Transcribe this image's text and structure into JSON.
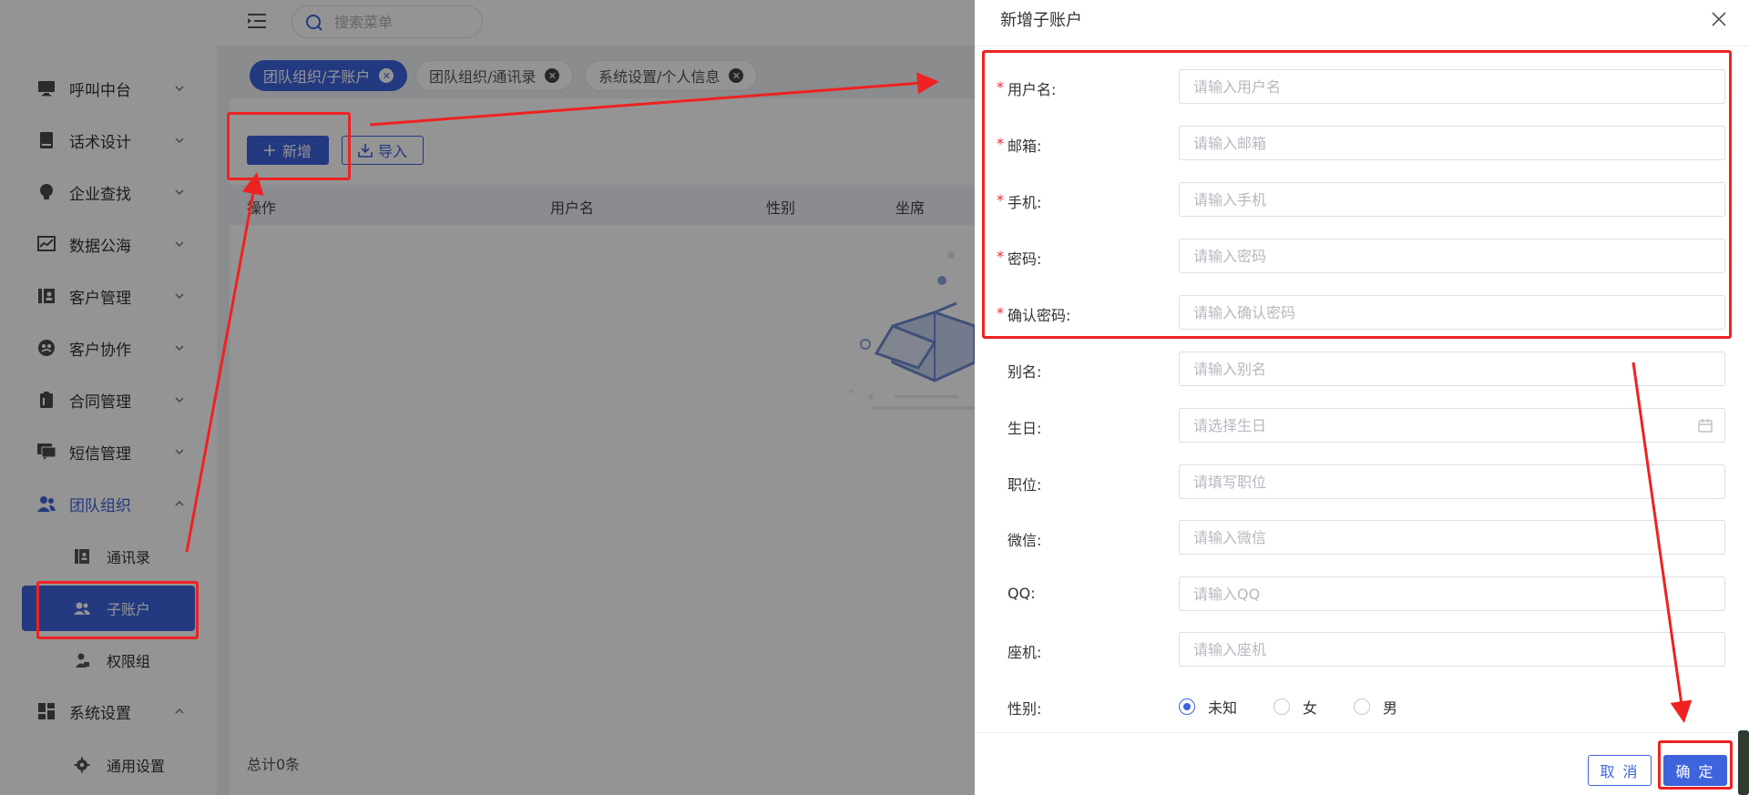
{
  "topbar": {
    "search_placeholder": "搜索菜单"
  },
  "sidebar": {
    "menus": [
      {
        "label": "呼叫中台",
        "icon": "monitor-icon"
      },
      {
        "label": "话术设计",
        "icon": "book-icon"
      },
      {
        "label": "企业查找",
        "icon": "lightbulb-icon"
      },
      {
        "label": "数据公海",
        "icon": "chart-icon"
      },
      {
        "label": "客户管理",
        "icon": "contact-book-icon"
      },
      {
        "label": "客户协作",
        "icon": "collaboration-icon"
      },
      {
        "label": "合同管理",
        "icon": "clipboard-icon"
      },
      {
        "label": "短信管理",
        "icon": "message-icon"
      },
      {
        "label": "团队组织",
        "icon": "team-icon"
      },
      {
        "label": "系统设置",
        "icon": "dashboard-icon"
      }
    ],
    "team_sub": [
      {
        "label": "通讯录",
        "icon": "address-book-icon"
      },
      {
        "label": "子账户",
        "icon": "users-icon"
      },
      {
        "label": "权限组",
        "icon": "user-lock-icon"
      }
    ],
    "settings_sub": [
      {
        "label": "通用设置",
        "icon": "gear-icon"
      }
    ]
  },
  "tabs": [
    {
      "label": "团队组织/子账户"
    },
    {
      "label": "团队组织/通讯录"
    },
    {
      "label": "系统设置/个人信息"
    }
  ],
  "content": {
    "add_label": "新增",
    "import_label": "导入",
    "columns": [
      "操作",
      "用户名",
      "性别",
      "坐席"
    ],
    "total": "总计0条"
  },
  "drawer": {
    "title": "新增子账户",
    "fields": [
      {
        "label": "用户名:",
        "placeholder": "请输入用户名",
        "required": true
      },
      {
        "label": "邮箱:",
        "placeholder": "请输入邮箱",
        "required": true
      },
      {
        "label": "手机:",
        "placeholder": "请输入手机",
        "required": true
      },
      {
        "label": "密码:",
        "placeholder": "请输入密码",
        "required": true
      },
      {
        "label": "确认密码:",
        "placeholder": "请输入确认密码",
        "required": true
      },
      {
        "label": "别名:",
        "placeholder": "请输入别名",
        "required": false
      },
      {
        "label": "生日:",
        "placeholder": "请选择生日",
        "required": false
      },
      {
        "label": "职位:",
        "placeholder": "请填写职位",
        "required": false
      },
      {
        "label": "微信:",
        "placeholder": "请输入微信",
        "required": false
      },
      {
        "label": "QQ:",
        "placeholder": "请输入QQ",
        "required": false
      },
      {
        "label": "座机:",
        "placeholder": "请输入座机",
        "required": false
      }
    ],
    "required_mark": "*",
    "gender_label": "性别:",
    "gender_options": [
      "未知",
      "女",
      "男"
    ],
    "gender_selected": "未知",
    "cancel_label": "取 消",
    "ok_label": "确 定"
  },
  "colors": {
    "primary": "#3d63dd",
    "annotation": "#ee2222",
    "required": "#f5222d"
  }
}
